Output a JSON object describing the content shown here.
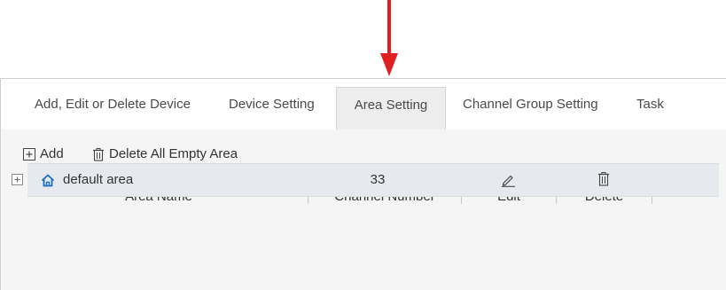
{
  "tabs": [
    {
      "label": "Add, Edit or Delete Device",
      "active": false
    },
    {
      "label": "Device Setting",
      "active": false
    },
    {
      "label": "Area Setting",
      "active": true
    },
    {
      "label": "Channel Group Setting",
      "active": false
    },
    {
      "label": "Task",
      "active": false
    }
  ],
  "toolbar": {
    "add_label": "Add",
    "delete_all_label": "Delete All Empty Area"
  },
  "table": {
    "columns": [
      "Area Name",
      "Channel Number",
      "Edit",
      "Delete"
    ],
    "rows": [
      {
        "area_name": "default area",
        "channel_number": "33",
        "icon": "home-icon"
      }
    ]
  },
  "annotation": {
    "arrow_color": "#e02020",
    "accent": "#1a6fc4"
  }
}
